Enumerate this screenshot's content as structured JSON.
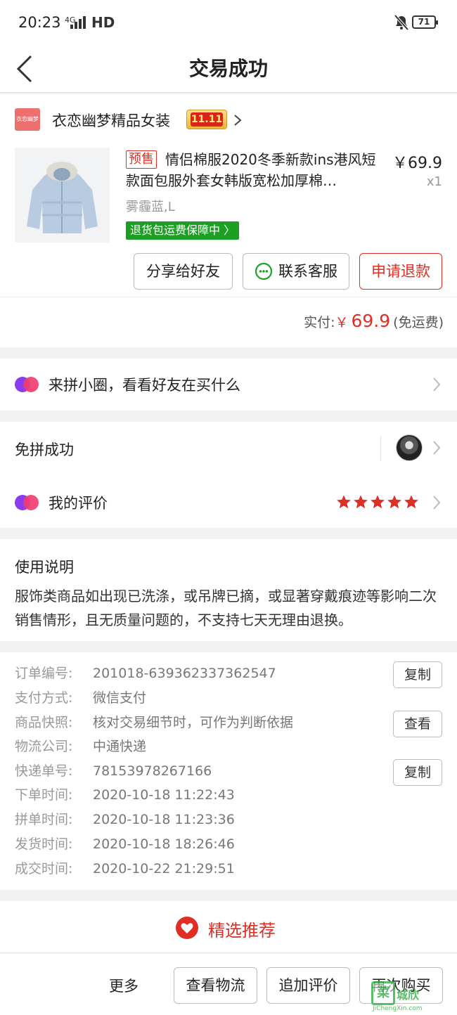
{
  "status_bar": {
    "time": "20:23",
    "network": "4G",
    "hd": "HD",
    "battery": "71"
  },
  "nav": {
    "title": "交易成功"
  },
  "shop": {
    "logo_text": "衣恋幽梦",
    "name": "衣恋幽梦精品女装",
    "badge": "11.11"
  },
  "product": {
    "presale_tag": "预售",
    "title": "情侣棉服2020冬季新款ins港风短款面包服外套女韩版宽松加厚棉…",
    "price": "￥69.9",
    "qty": "x1",
    "spec": "雾霾蓝,L",
    "guarantee": "退货包运费保障中"
  },
  "actions": {
    "share": "分享给好友",
    "service": "联系客服",
    "refund": "申请退款"
  },
  "payment": {
    "label": "实付:",
    "currency": "￥",
    "amount": "69.9",
    "note": "(免运费)"
  },
  "circle": {
    "text": "来拼小圈，看看好友在买什么"
  },
  "group": {
    "status": "免拼成功",
    "review_label": "我的评价",
    "rating": 5
  },
  "notice": {
    "title": "使用说明",
    "text": "服饰类商品如出现已洗涤，或吊牌已摘，或显著穿戴痕迹等影响二次销售情形，且无质量问题的，不支持七天无理由退换。"
  },
  "order": {
    "rows": [
      {
        "label": "订单编号:",
        "value": "201018-639362337362547"
      },
      {
        "label": "支付方式:",
        "value": "微信支付"
      },
      {
        "label": "商品快照:",
        "value": "核对交易细节时，可作为判断依据"
      },
      {
        "label": "物流公司:",
        "value": "中通快递"
      },
      {
        "label": "快递单号:",
        "value": "78153978267166"
      },
      {
        "label": "下单时间:",
        "value": "2020-10-18 11:22:43"
      },
      {
        "label": "拼单时间:",
        "value": "2020-10-18 11:23:36"
      },
      {
        "label": "发货时间:",
        "value": "2020-10-18 18:26:46"
      },
      {
        "label": "成交时间:",
        "value": "2020-10-22 21:29:51"
      }
    ],
    "copy_label": "复制",
    "view_label": "查看"
  },
  "recommend": {
    "title": "精选推荐"
  },
  "bottom": {
    "more": "更多",
    "logistics": "查看物流",
    "add_review": "追加评价",
    "rebuy": "再次购买"
  },
  "watermark": {
    "mark": "菜",
    "name": "城欣",
    "url": "JiChengXin.com"
  },
  "colors": {
    "accent": "#e02e24",
    "green": "#1ca024",
    "star": "#e02e24"
  }
}
